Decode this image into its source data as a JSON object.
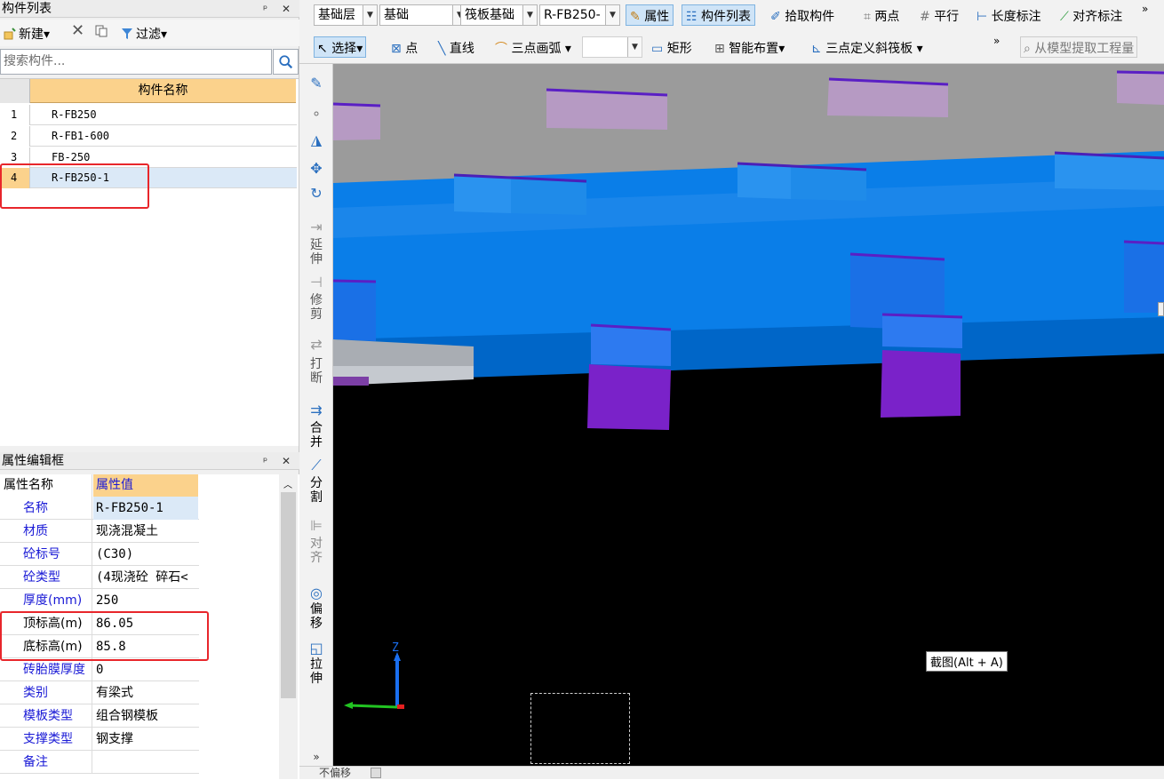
{
  "component_panel": {
    "title": "构件列表",
    "pin_close": "ᵖ ✕",
    "toolbar": {
      "new_label": "新建",
      "filter_label": "过滤"
    },
    "search_placeholder": "搜索构件...",
    "column_header": "构件名称",
    "rows": [
      {
        "index": "1",
        "name": "R-FB250"
      },
      {
        "index": "2",
        "name": "R-FB1-600"
      },
      {
        "index": "3",
        "name": "FB-250"
      },
      {
        "index": "4",
        "name": "R-FB250-1"
      }
    ],
    "selected_index": "4"
  },
  "property_panel": {
    "title": "属性编辑框",
    "pin_close": "ᵖ ✕",
    "col_name": "属性名称",
    "col_value": "属性值",
    "rows": [
      {
        "name": "名称",
        "value": "R-FB250-1"
      },
      {
        "name": "材质",
        "value": "现浇混凝土"
      },
      {
        "name": "砼标号",
        "value": "(C30)"
      },
      {
        "name": "砼类型",
        "value": "(4现浇砼 碎石<"
      },
      {
        "name": "厚度(mm)",
        "value": "250"
      },
      {
        "name": "顶标高(m)",
        "value": "86.05"
      },
      {
        "name": "底标高(m)",
        "value": "85.8"
      },
      {
        "name": "砖胎膜厚度",
        "value": "0"
      },
      {
        "name": "类别",
        "value": "有梁式"
      },
      {
        "name": "模板类型",
        "value": "组合钢模板"
      },
      {
        "name": "支撑类型",
        "value": "钢支撑"
      },
      {
        "name": "备注",
        "value": ""
      }
    ]
  },
  "toolbar1": {
    "floor_combo": "基础层",
    "sub_combo": "基础",
    "type_combo": "筏板基础",
    "component_combo": "R-FB250-",
    "properties_btn": "属性",
    "component_list_btn": "构件列表",
    "pick_btn": "拾取构件",
    "two_point_btn": "两点",
    "parallel_btn": "平行",
    "length_dim_btn": "长度标注",
    "align_dim_btn": "对齐标注"
  },
  "toolbar2": {
    "select_btn": "选择",
    "point_btn": "点",
    "line_btn": "直线",
    "arc_btn": "三点画弧",
    "rect_btn": "矩形",
    "smart_layout_btn": "智能布置",
    "slope_btn": "三点定义斜筏板",
    "extract_btn": "从模型提取工程量"
  },
  "vertical_tools": [
    "延伸",
    "修剪",
    "打断",
    "合并",
    "分割",
    "对齐",
    "偏移",
    "拉伸"
  ],
  "viewport": {
    "tooltip": "截图(Alt + A)",
    "axis_label_z": "Z"
  },
  "status_bar": {
    "left_text": "不偏移"
  }
}
